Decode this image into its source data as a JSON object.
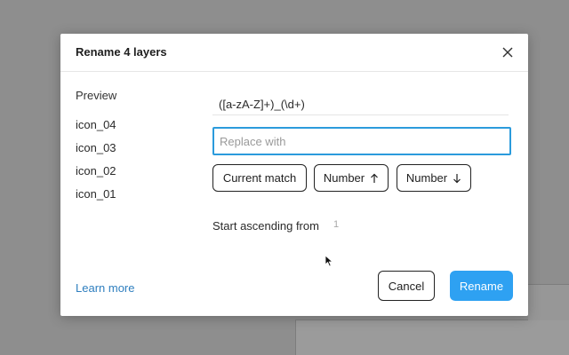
{
  "dialog": {
    "title": "Rename 4 layers",
    "close_icon": "close-icon"
  },
  "preview": {
    "label": "Preview",
    "layers": [
      "icon_04",
      "icon_03",
      "icon_02",
      "icon_01"
    ]
  },
  "find": {
    "value": "([a-zA-Z]+)_(\\d+)"
  },
  "replace": {
    "value": "",
    "placeholder": "Replace with"
  },
  "tokens": {
    "current_match": "Current match",
    "number_up": "Number",
    "number_up_icon": "arrow-up-icon",
    "number_down": "Number",
    "number_down_icon": "arrow-down-icon"
  },
  "start": {
    "label": "Start ascending from",
    "value": "1"
  },
  "footer": {
    "learn_more": "Learn more",
    "cancel": "Cancel",
    "rename": "Rename"
  },
  "colors": {
    "accent": "#2ea1f2",
    "focus": "#2b9bdc",
    "link": "#2f7fbf"
  }
}
